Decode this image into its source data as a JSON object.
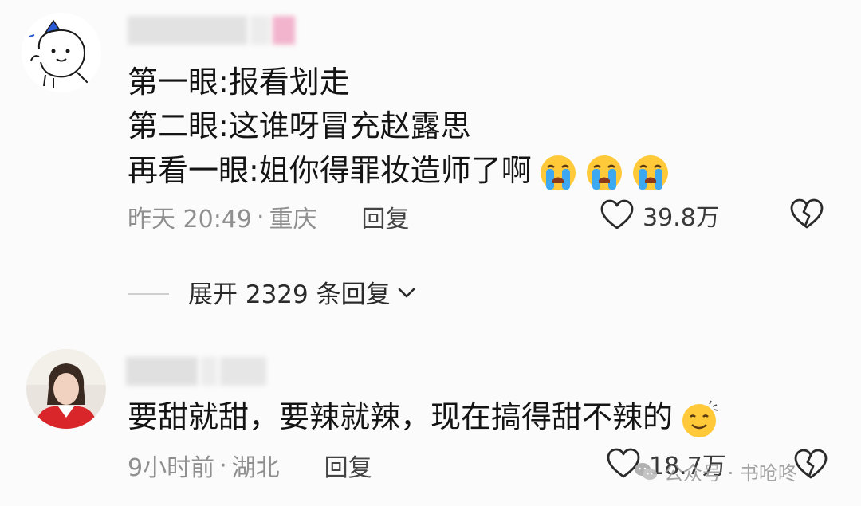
{
  "comments": [
    {
      "lines": [
        "第一眼:报看划走",
        "第二眼:这谁呀冒充赵露思",
        "再看一眼:姐你得罪妆造师了啊"
      ],
      "emojis": [
        "crying-face-emoji",
        "crying-face-emoji",
        "crying-face-emoji"
      ],
      "time": "昨天 20:49",
      "separator": "·",
      "location": "重庆",
      "reply_label": "回复",
      "likes": "39.8万"
    },
    {
      "lines": [
        "要甜就甜，要辣就辣，现在搞得甜不辣的"
      ],
      "emojis": [
        "smiling-face-emoji"
      ],
      "time": "9小时前",
      "separator": "·",
      "location": "湖北",
      "reply_label": "回复",
      "likes": "18.7万"
    }
  ],
  "expand_replies": {
    "label": "展开 2329 条回复"
  },
  "watermark": {
    "text": "公众号 · 书呛咚"
  },
  "colors": {
    "text_primary": "#141414",
    "text_meta": "#8f8f8f",
    "emoji_face": "#ffc93a",
    "emoji_tear": "#3da8f0",
    "blur_pink": "#f4b6cf",
    "blur_gray": "#dcdcdc"
  }
}
